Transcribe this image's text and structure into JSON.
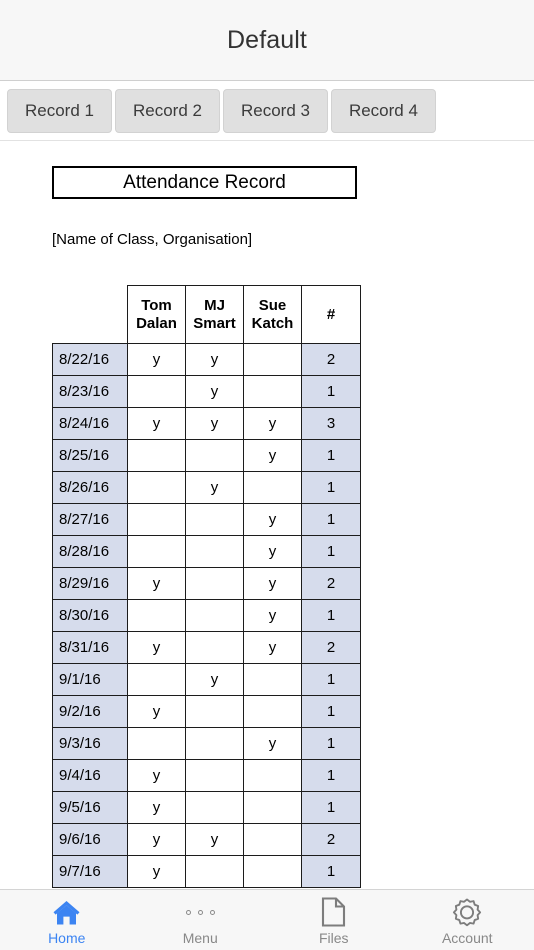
{
  "navbar": {
    "title": "Default"
  },
  "segments": [
    {
      "label": "Record 1"
    },
    {
      "label": "Record 2"
    },
    {
      "label": "Record 3"
    },
    {
      "label": "Record 4"
    }
  ],
  "document": {
    "title": "Attendance Record",
    "subtitle": "[Name of Class, Organisation]"
  },
  "chart_data": {
    "type": "table",
    "title": "Attendance Record",
    "columns": [
      "",
      "Tom Dalan",
      "MJ Smart",
      "Sue Katch",
      "#"
    ],
    "column_lines": [
      [
        "",
        ""
      ],
      [
        "Tom",
        "Dalan"
      ],
      [
        "MJ",
        "Smart"
      ],
      [
        "Sue",
        "Katch"
      ],
      [
        "#",
        ""
      ]
    ],
    "rows": [
      {
        "date": "8/22/16",
        "marks": [
          "y",
          "y",
          ""
        ],
        "count": "2"
      },
      {
        "date": "8/23/16",
        "marks": [
          "",
          "y",
          ""
        ],
        "count": "1"
      },
      {
        "date": "8/24/16",
        "marks": [
          "y",
          "y",
          "y"
        ],
        "count": "3"
      },
      {
        "date": "8/25/16",
        "marks": [
          "",
          "",
          "y"
        ],
        "count": "1"
      },
      {
        "date": "8/26/16",
        "marks": [
          "",
          "y",
          ""
        ],
        "count": "1"
      },
      {
        "date": "8/27/16",
        "marks": [
          "",
          "",
          "y"
        ],
        "count": "1"
      },
      {
        "date": "8/28/16",
        "marks": [
          "",
          "",
          "y"
        ],
        "count": "1"
      },
      {
        "date": "8/29/16",
        "marks": [
          "y",
          "",
          "y"
        ],
        "count": "2"
      },
      {
        "date": "8/30/16",
        "marks": [
          "",
          "",
          "y"
        ],
        "count": "1"
      },
      {
        "date": "8/31/16",
        "marks": [
          "y",
          "",
          "y"
        ],
        "count": "2"
      },
      {
        "date": "9/1/16",
        "marks": [
          "",
          "y",
          ""
        ],
        "count": "1"
      },
      {
        "date": "9/2/16",
        "marks": [
          "y",
          "",
          ""
        ],
        "count": "1"
      },
      {
        "date": "9/3/16",
        "marks": [
          "",
          "",
          "y"
        ],
        "count": "1"
      },
      {
        "date": "9/4/16",
        "marks": [
          "y",
          "",
          ""
        ],
        "count": "1"
      },
      {
        "date": "9/5/16",
        "marks": [
          "y",
          "",
          ""
        ],
        "count": "1"
      },
      {
        "date": "9/6/16",
        "marks": [
          "y",
          "y",
          ""
        ],
        "count": "2"
      },
      {
        "date": "9/7/16",
        "marks": [
          "y",
          "",
          ""
        ],
        "count": "1"
      }
    ],
    "highlight_color": "#d6dcec",
    "border_color": "#1c1c1c"
  },
  "tabbar": {
    "active_color": "#3c84f2",
    "inactive_color": "#888888",
    "items": [
      {
        "label": "Home",
        "icon": "home-icon",
        "active": true
      },
      {
        "label": "Menu",
        "icon": "dots-icon",
        "active": false
      },
      {
        "label": "Files",
        "icon": "file-icon",
        "active": false
      },
      {
        "label": "Account",
        "icon": "gear-icon",
        "active": false
      }
    ]
  }
}
